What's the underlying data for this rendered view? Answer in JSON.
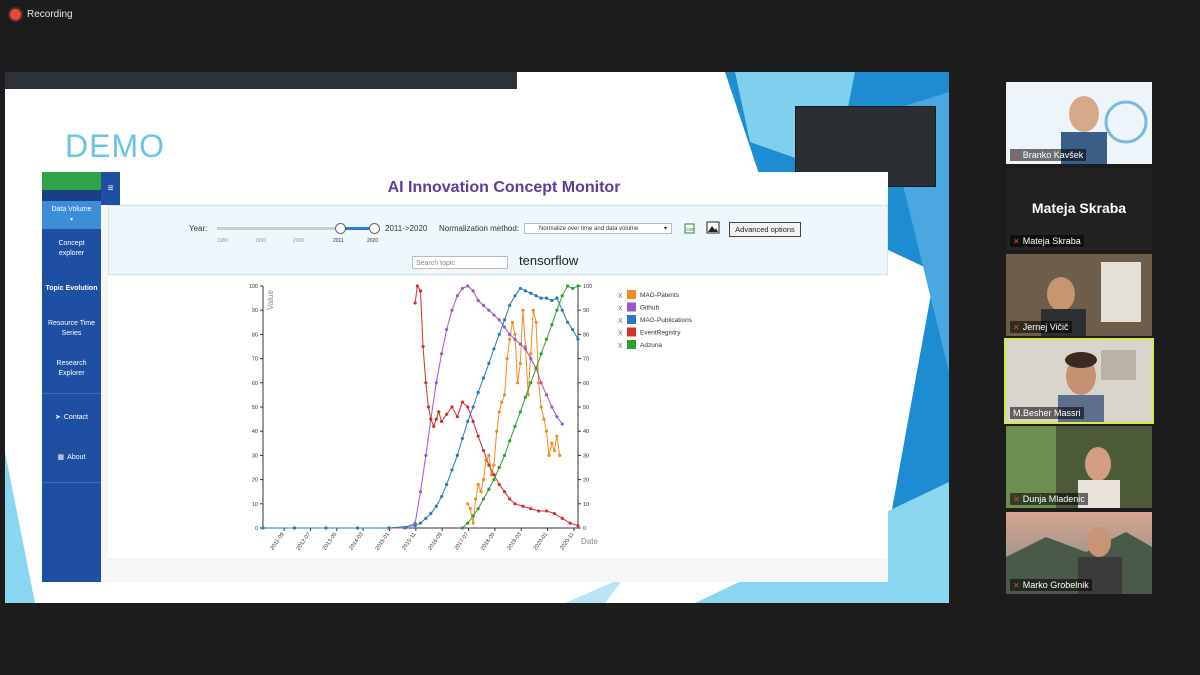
{
  "recording": {
    "label": "Recording"
  },
  "slide": {
    "heading": "DEMO"
  },
  "app": {
    "title": "AI Innovation Concept Monitor",
    "sidebar": [
      {
        "label": "Data Volume",
        "active": true
      },
      {
        "label": "Concept explorer"
      },
      {
        "label": "Topic Evolution",
        "bold": true
      },
      {
        "label": "Resource Time Series"
      },
      {
        "label": "Research Explorer"
      },
      {
        "label": "Contact",
        "icon": "paper-plane-icon"
      },
      {
        "label": "About",
        "icon": "briefcase-icon"
      }
    ],
    "controls": {
      "year_label": "Year:",
      "year_range": "2011->2020",
      "year_ticks": [
        "1980",
        "1990",
        "2000",
        "2011",
        "2020"
      ],
      "norm_label": "Normalization method:",
      "norm_value": "Normalize over time and data volume",
      "advanced": "Advanced options",
      "search_placeholder": "Search topic",
      "topic": "tensorflow"
    }
  },
  "chart_data": {
    "type": "line",
    "ylabel": "Value",
    "xlabel": "Date",
    "ylim": [
      0,
      100
    ],
    "x_ticks": [
      "2011-09",
      "2012-07",
      "2013-05",
      "2014-03",
      "2015-01",
      "2015-11",
      "2016-09",
      "2017-07",
      "2018-05",
      "2019-03",
      "2020-01",
      "2020-11"
    ],
    "y_ticks": [
      0,
      10,
      20,
      30,
      40,
      50,
      60,
      70,
      80,
      90,
      100
    ],
    "series": [
      {
        "name": "MAG-Patents",
        "color": "#f28b20",
        "x": [
          2017.5,
          2017.58,
          2017.67,
          2017.75,
          2017.83,
          2017.92,
          2018.0,
          2018.08,
          2018.17,
          2018.25,
          2018.33,
          2018.42,
          2018.5,
          2018.58,
          2018.67,
          2018.75,
          2018.83,
          2018.92,
          2019.0,
          2019.08,
          2019.17,
          2019.25,
          2019.33,
          2019.42,
          2019.5,
          2019.58,
          2019.67,
          2019.75,
          2019.83,
          2019.92,
          2020.0,
          2020.08,
          2020.17,
          2020.25,
          2020.33,
          2020.42
        ],
        "values": [
          10,
          8,
          2,
          12,
          18,
          15,
          20,
          28,
          30,
          22,
          26,
          40,
          48,
          52,
          55,
          70,
          78,
          85,
          80,
          60,
          68,
          90,
          75,
          55,
          72,
          90,
          85,
          60,
          50,
          45,
          40,
          30,
          35,
          32,
          38,
          30
        ]
      },
      {
        "name": "Github",
        "color": "#9b59c6",
        "x": [
          2011.0,
          2012.0,
          2013.0,
          2014.0,
          2015.0,
          2015.5,
          2015.83,
          2016.0,
          2016.17,
          2016.33,
          2016.5,
          2016.67,
          2016.83,
          2017.0,
          2017.17,
          2017.33,
          2017.5,
          2017.67,
          2017.83,
          2018.0,
          2018.17,
          2018.33,
          2018.5,
          2018.67,
          2018.83,
          2019.0,
          2019.17,
          2019.33,
          2019.5,
          2019.67,
          2019.83,
          2020.0,
          2020.17,
          2020.33,
          2020.5
        ],
        "values": [
          0,
          0,
          0,
          0,
          0,
          0,
          2,
          15,
          30,
          45,
          60,
          72,
          82,
          90,
          96,
          99,
          100,
          98,
          94,
          92,
          90,
          88,
          86,
          83,
          80,
          78,
          76,
          74,
          70,
          66,
          60,
          55,
          50,
          46,
          43
        ]
      },
      {
        "name": "MAG-Publications",
        "color": "#2a7ab8",
        "x": [
          2011.0,
          2012.0,
          2013.0,
          2014.0,
          2015.0,
          2015.83,
          2016.0,
          2016.17,
          2016.33,
          2016.5,
          2016.67,
          2016.83,
          2017.0,
          2017.17,
          2017.33,
          2017.5,
          2017.67,
          2017.83,
          2018.0,
          2018.17,
          2018.33,
          2018.5,
          2018.67,
          2018.83,
          2019.0,
          2019.17,
          2019.33,
          2019.5,
          2019.67,
          2019.83,
          2020.0,
          2020.17,
          2020.33,
          2020.5,
          2020.67,
          2020.83,
          2021.0
        ],
        "values": [
          0,
          0,
          0,
          0,
          0,
          1,
          2,
          4,
          6,
          9,
          13,
          18,
          24,
          30,
          37,
          44,
          50,
          56,
          62,
          68,
          74,
          80,
          86,
          92,
          96,
          99,
          98,
          97,
          96,
          95,
          95,
          94,
          95,
          90,
          85,
          82,
          78
        ]
      },
      {
        "name": "EventRegistry",
        "color": "#d0312d",
        "x": [
          2015.83,
          2015.9,
          2016.0,
          2016.08,
          2016.17,
          2016.25,
          2016.33,
          2016.42,
          2016.5,
          2016.58,
          2016.67,
          2016.83,
          2017.0,
          2017.17,
          2017.33,
          2017.5,
          2017.67,
          2017.83,
          2018.0,
          2018.17,
          2018.33,
          2018.5,
          2018.67,
          2018.83,
          2019.0,
          2019.25,
          2019.5,
          2019.75,
          2020.0,
          2020.25,
          2020.5,
          2020.75,
          2021.0
        ],
        "values": [
          93,
          100,
          98,
          75,
          60,
          50,
          45,
          42,
          45,
          48,
          44,
          47,
          50,
          46,
          52,
          50,
          44,
          38,
          32,
          26,
          22,
          18,
          15,
          12,
          10,
          9,
          8,
          7,
          7,
          6,
          4,
          2,
          1
        ]
      },
      {
        "name": "Adzuna",
        "color": "#2ca02c",
        "x": [
          2017.33,
          2017.5,
          2017.67,
          2017.83,
          2018.0,
          2018.17,
          2018.33,
          2018.5,
          2018.67,
          2018.83,
          2019.0,
          2019.17,
          2019.33,
          2019.5,
          2019.67,
          2019.83,
          2020.0,
          2020.17,
          2020.33,
          2020.5,
          2020.67,
          2020.83,
          2021.0
        ],
        "values": [
          0,
          2,
          5,
          8,
          12,
          16,
          20,
          25,
          30,
          36,
          42,
          48,
          54,
          60,
          66,
          72,
          78,
          84,
          90,
          96,
          100,
          99,
          100
        ]
      }
    ],
    "legend_placement": "right",
    "grid": false
  },
  "participants": [
    {
      "name": "Branko Kavšek"
    },
    {
      "name": "Mateja Skraba",
      "no_video": true
    },
    {
      "name": "Jernej Vičič"
    },
    {
      "name": "M.Besher Massri",
      "active": true
    },
    {
      "name": "Dunja Mladenic"
    },
    {
      "name": "Marko Grobelnik"
    }
  ],
  "colors": {
    "accent": "#5c3d9a",
    "sidebar": "#1e4fa2",
    "demo": "#69c6e3"
  }
}
